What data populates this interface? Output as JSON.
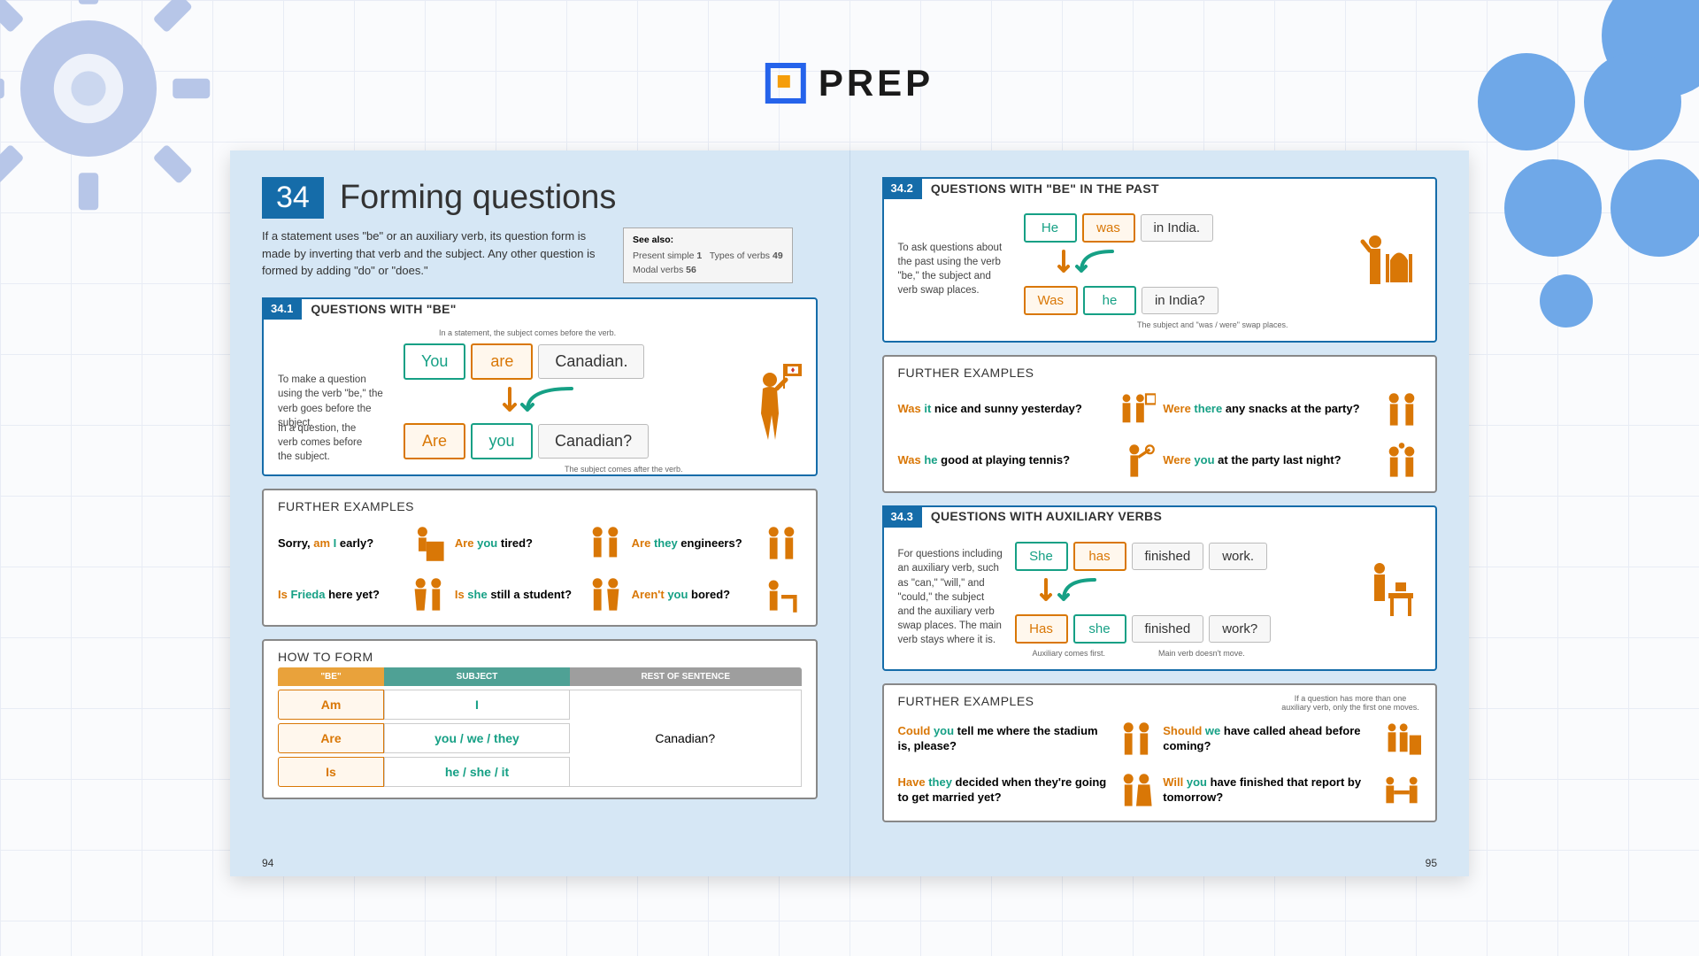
{
  "brand": {
    "name": "PREP"
  },
  "chapter": {
    "number": "34",
    "title": "Forming questions"
  },
  "intro": "If a statement uses \"be\" or an auxiliary verb, its question form is made by inverting that verb and the subject. Any other question is formed by adding \"do\" or \"does.\"",
  "see_also": {
    "label": "See also:",
    "refs": [
      {
        "name": "Present simple",
        "num": "1"
      },
      {
        "name": "Types of verbs",
        "num": "49"
      },
      {
        "name": "Modal verbs",
        "num": "56"
      }
    ]
  },
  "page_numbers": {
    "left": "94",
    "right": "95"
  },
  "s341": {
    "tag": "34.1",
    "title": "QUESTIONS WITH \"BE\"",
    "note_top": "To make a question using the verb \"be,\" the verb goes before the subject.",
    "cap_stmt": "In a statement, the subject comes before the verb.",
    "stmt": {
      "subj": "You",
      "verb": "are",
      "rest": "Canadian."
    },
    "note_q": "In a question, the verb comes before the subject.",
    "cap_q": "The subject comes after the verb.",
    "ques": {
      "verb": "Are",
      "subj": "you",
      "rest": "Canadian?"
    }
  },
  "s341_examples": {
    "title": "FURTHER EXAMPLES",
    "items": [
      {
        "pre": "Sorry, ",
        "aux": "am",
        "subj": " I",
        "post": " early?"
      },
      {
        "aux": "Are ",
        "subj": "you",
        "post": " tired?"
      },
      {
        "aux": "Are ",
        "subj": "they",
        "post": " engineers?"
      },
      {
        "aux": "Is ",
        "subj": "Frieda",
        "post": " here yet?"
      },
      {
        "aux": "Is ",
        "subj": "she",
        "post": " still a student?"
      },
      {
        "aux": "Aren't ",
        "subj": "you",
        "post": " bored?"
      }
    ]
  },
  "howto": {
    "title": "HOW TO FORM",
    "headers": {
      "be": "\"BE\"",
      "subj": "SUBJECT",
      "rest": "REST OF SENTENCE"
    },
    "rows": [
      {
        "be": "Am",
        "subj": "I"
      },
      {
        "be": "Are",
        "subj": "you / we / they"
      },
      {
        "be": "Is",
        "subj": "he / she / it"
      }
    ],
    "rest": "Canadian?"
  },
  "s342": {
    "tag": "34.2",
    "title": "QUESTIONS WITH \"BE\" IN THE PAST",
    "note": "To ask questions about the past using the verb \"be,\" the subject and verb swap places.",
    "stmt": {
      "subj": "He",
      "verb": "was",
      "rest": "in India."
    },
    "ques": {
      "verb": "Was",
      "subj": "he",
      "rest": "in India?"
    },
    "cap": "The subject and \"was / were\" swap places."
  },
  "s342_examples": {
    "title": "FURTHER EXAMPLES",
    "items": [
      {
        "aux": "Was ",
        "subj": "it",
        "post": " nice and sunny yesterday?"
      },
      {
        "aux": "Were ",
        "subj": "there",
        "post": " any snacks at the party?"
      },
      {
        "aux": "Was ",
        "subj": "he",
        "post": " good at playing tennis?"
      },
      {
        "aux": "Were ",
        "subj": "you",
        "post": " at the party last night?"
      }
    ]
  },
  "s343": {
    "tag": "34.3",
    "title": "QUESTIONS WITH AUXILIARY VERBS",
    "note": "For questions including an auxiliary verb, such as \"can,\" \"will,\" and \"could,\" the subject and the auxiliary verb swap places. The main verb stays where it is.",
    "stmt": {
      "subj": "She",
      "aux": "has",
      "verb": "finished",
      "rest": "work."
    },
    "ques": {
      "aux": "Has",
      "subj": "she",
      "verb": "finished",
      "rest": "work?"
    },
    "cap_aux": "Auxiliary comes first.",
    "cap_verb": "Main verb doesn't move."
  },
  "s343_examples": {
    "title": "FURTHER EXAMPLES",
    "tip": "If a question has more than one auxiliary verb, only the first one moves.",
    "items": [
      {
        "aux": "Could ",
        "subj": "you",
        "post": " tell me where the stadium is, please?"
      },
      {
        "aux": "Should ",
        "subj": "we",
        "post": " have called ahead before coming?"
      },
      {
        "aux": "Have ",
        "subj": "they",
        "post": " decided when they're going to get married yet?"
      },
      {
        "aux": "Will ",
        "subj": "you",
        "post": " have finished that report by tomorrow?"
      }
    ]
  }
}
